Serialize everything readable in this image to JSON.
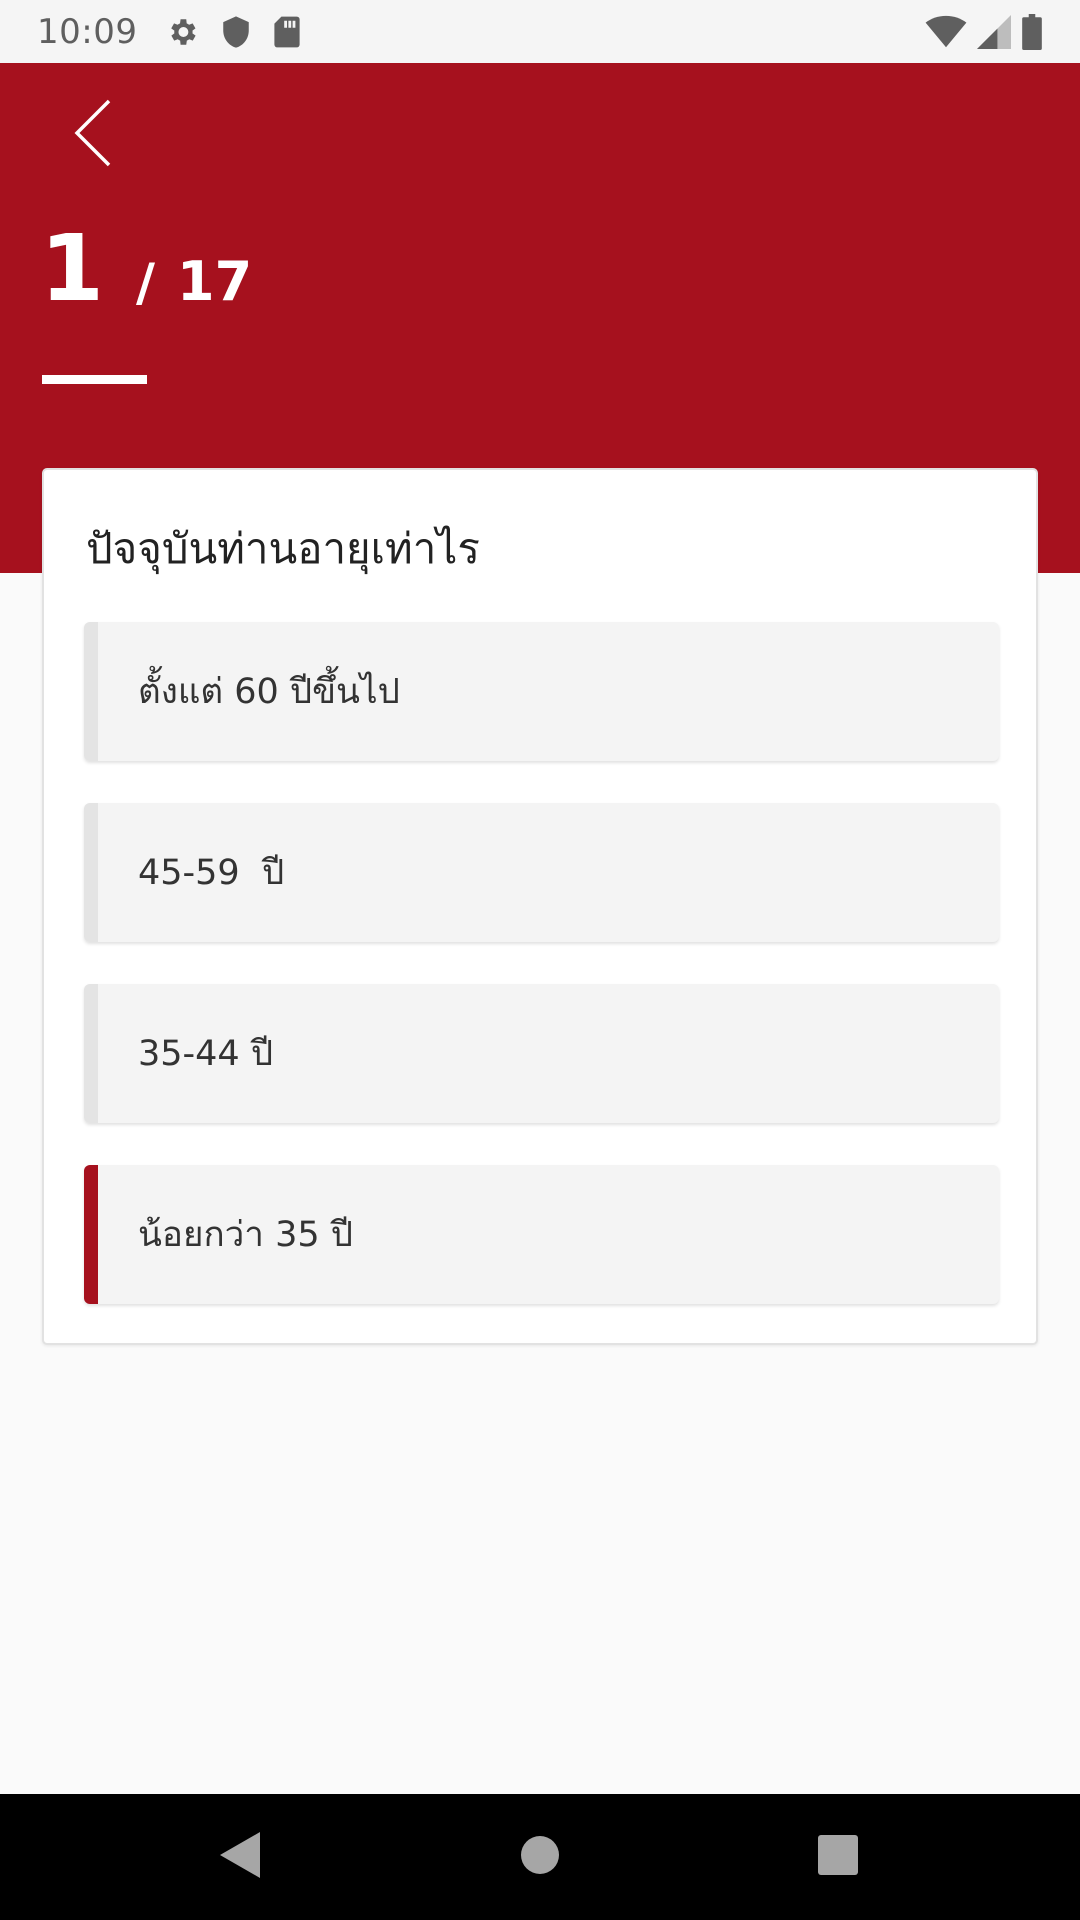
{
  "status_bar": {
    "time": "10:09",
    "icons": [
      "gear-icon",
      "shield-icon",
      "sd-card-icon",
      "wifi-icon",
      "cell-signal-icon",
      "battery-icon"
    ]
  },
  "header": {
    "back_icon": "chevron-left-icon",
    "progress_current": "1",
    "progress_separator": "/",
    "progress_total": "17",
    "background_color": "#a6111e"
  },
  "question": {
    "title": "ปัจจุบันท่านอายุเท่าไร",
    "options": [
      {
        "label": "ตั้งแต่ 60 ปีขึ้นไป",
        "selected": false
      },
      {
        "label": "45-59  ปี",
        "selected": false
      },
      {
        "label": "35-44 ปี",
        "selected": false
      },
      {
        "label": "น้อยกว่า 35 ปี",
        "selected": true
      }
    ]
  },
  "nav_bar": {
    "icons": [
      "back-triangle-icon",
      "home-circle-icon",
      "recents-square-icon"
    ]
  }
}
